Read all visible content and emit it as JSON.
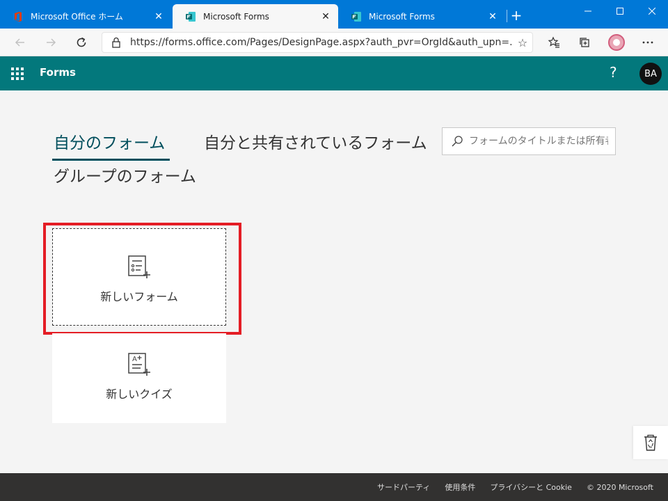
{
  "browser": {
    "tabs": [
      {
        "title": "Microsoft Office ホーム",
        "active": false,
        "icon": "office-icon"
      },
      {
        "title": "Microsoft Forms",
        "active": true,
        "icon": "forms-icon"
      },
      {
        "title": "Microsoft Forms",
        "active": false,
        "icon": "forms-icon"
      }
    ],
    "close_glyph": "✕",
    "new_tab_glyph": "+",
    "url": "https://forms.office.com/Pages/DesignPage.aspx?auth_pvr=OrgId&auth_upn=..."
  },
  "app": {
    "name": "Forms",
    "help": "?",
    "user_initials": "BA",
    "brand_color": "#03787c"
  },
  "content_tabs": {
    "my_forms": "自分のフォーム",
    "shared_with_me": "自分と共有されているフォーム",
    "group_forms": "グループのフォーム"
  },
  "search": {
    "placeholder": "フォームのタイトルまたは所有者で検索"
  },
  "cards": {
    "new_form": "新しいフォーム",
    "new_quiz": "新しいクイズ"
  },
  "highlight_color": "#e41d25",
  "footer": {
    "links": [
      "サードパーティ",
      "使用条件",
      "プライバシーと Cookie",
      "© 2020 Microsoft"
    ]
  }
}
